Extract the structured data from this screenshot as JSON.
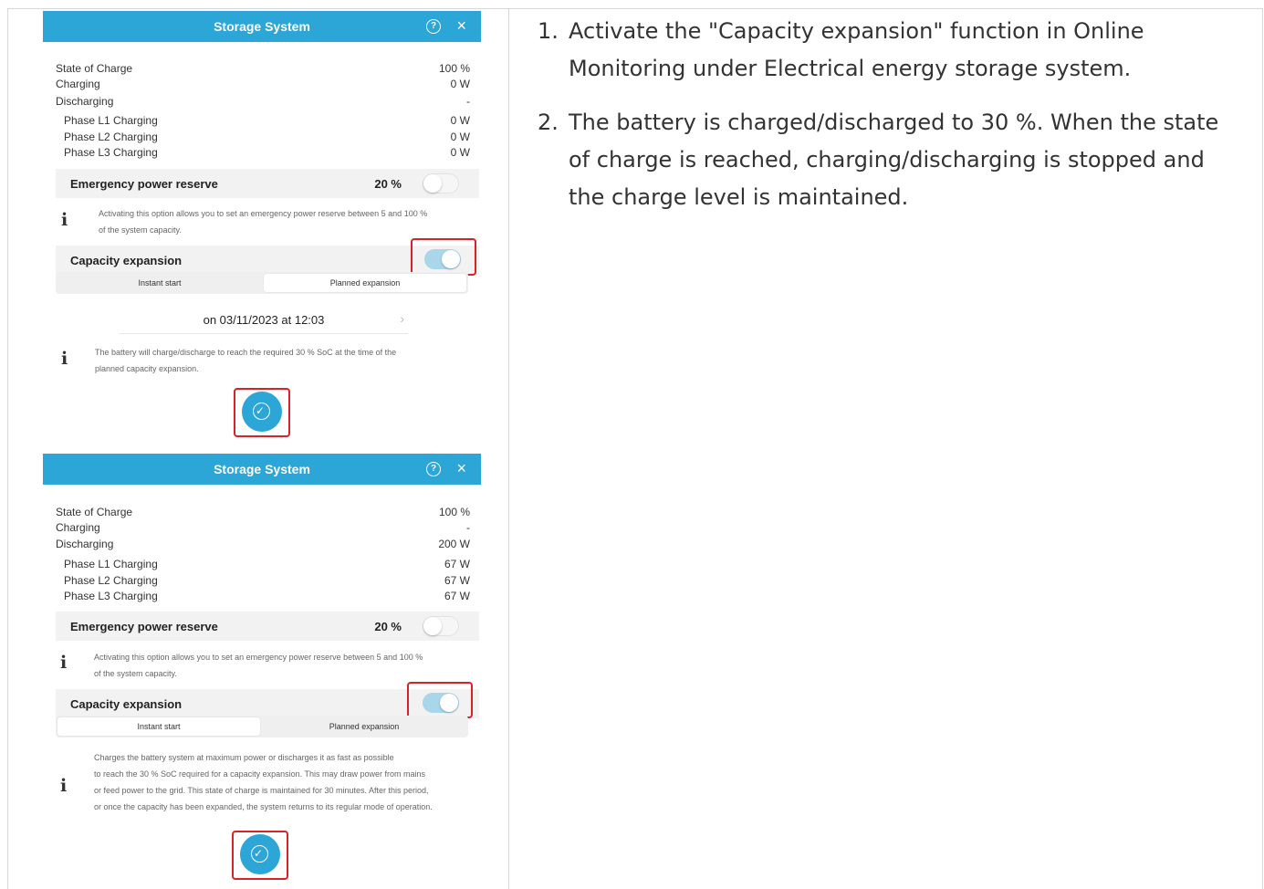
{
  "panel_top": {
    "title": "Storage System",
    "state_of_charge_label": "State of Charge",
    "state_of_charge_value": "100 %",
    "charging_label": "Charging",
    "charging_value": "0 W",
    "discharging_label": "Discharging",
    "discharging_value": "-",
    "phases": [
      {
        "label": "Phase L1 Charging",
        "value": "0 W"
      },
      {
        "label": "Phase L2 Charging",
        "value": "0 W"
      },
      {
        "label": "Phase L3 Charging",
        "value": "0 W"
      }
    ],
    "emergency_label": "Emergency power reserve",
    "emergency_value": "20 %",
    "emergency_note_1": "Activating this option allows you to set an emergency power reserve between 5 and 100 %",
    "emergency_note_2": "of the system capacity.",
    "capacity_label": "Capacity expansion",
    "seg_instant": "Instant start",
    "seg_planned": "Planned expansion",
    "date_text": "on 03/11/2023 at 12:03",
    "planned_note_1": "The battery will charge/discharge to reach the required 30 % SoC at the time of the",
    "planned_note_2": "planned capacity expansion."
  },
  "panel_bottom": {
    "title": "Storage System",
    "state_of_charge_label": "State of Charge",
    "state_of_charge_value": "100 %",
    "charging_label": "Charging",
    "charging_value": "-",
    "discharging_label": "Discharging",
    "discharging_value": "200 W",
    "phases": [
      {
        "label": "Phase L1 Charging",
        "value": "67 W"
      },
      {
        "label": "Phase L2 Charging",
        "value": "67 W"
      },
      {
        "label": "Phase L3 Charging",
        "value": "67 W"
      }
    ],
    "emergency_label": "Emergency power reserve",
    "emergency_value": "20 %",
    "emergency_note_1": "Activating this option allows you to set an emergency power reserve between 5 and 100 %",
    "emergency_note_2": "of the system capacity.",
    "capacity_label": "Capacity expansion",
    "seg_instant": "Instant start",
    "seg_planned": "Planned expansion",
    "instant_note_1": "Charges the battery system at maximum power or discharges it as fast as possible",
    "instant_note_2": "to reach the 30 % SoC required for a capacity expansion. This may draw power from mains",
    "instant_note_3": "or feed power to the grid. This state of charge is maintained for 30 minutes. After this period,",
    "instant_note_4": "or once the capacity has been expanded, the system returns to its regular mode of operation."
  },
  "steps": [
    {
      "num": "1.",
      "text": "Activate the \"Capacity expansion\" function in Online Monitoring under Electrical energy storage system."
    },
    {
      "num": "2.",
      "text": "The battery is charged/discharged to 30 %. When the state of charge is reached, charging/discharging is stopped and the charge level is maintained."
    }
  ],
  "colors": {
    "accent": "#2ba6d6",
    "highlight": "#d8222a"
  }
}
